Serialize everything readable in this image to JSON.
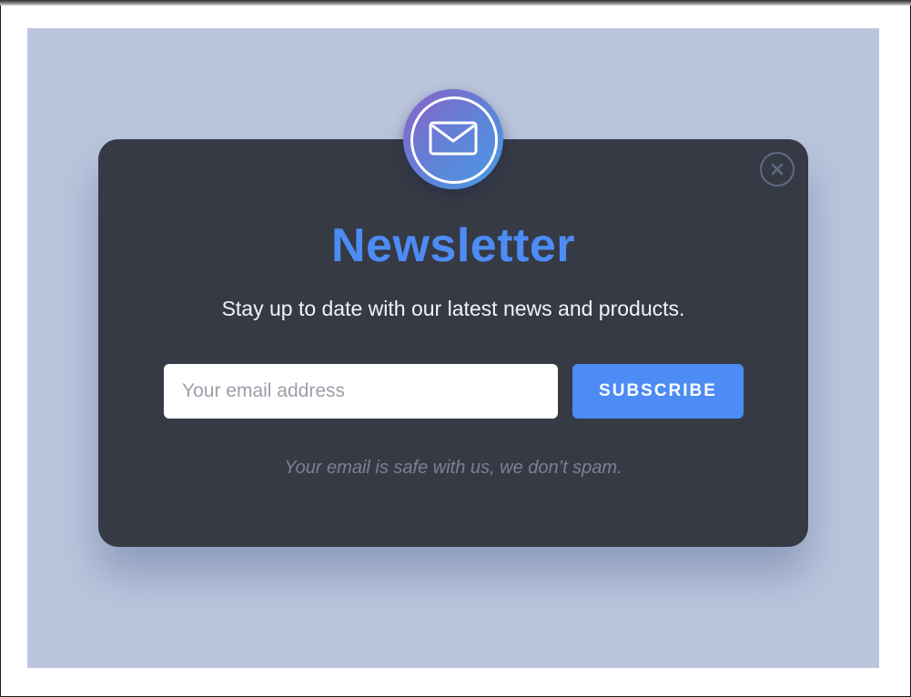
{
  "modal": {
    "title": "Newsletter",
    "subtitle": "Stay up to date with our latest news and products.",
    "email_placeholder": "Your email address",
    "subscribe_label": "SUBSCRIBE",
    "note": "Your email is safe with us, we don’t spam.",
    "badge_icon": "envelope-icon",
    "close_icon": "close-icon"
  },
  "colors": {
    "accent": "#4d8cf5",
    "modal_bg": "#363a45",
    "backdrop": "#bac5dd",
    "note_text": "#7c8191"
  }
}
